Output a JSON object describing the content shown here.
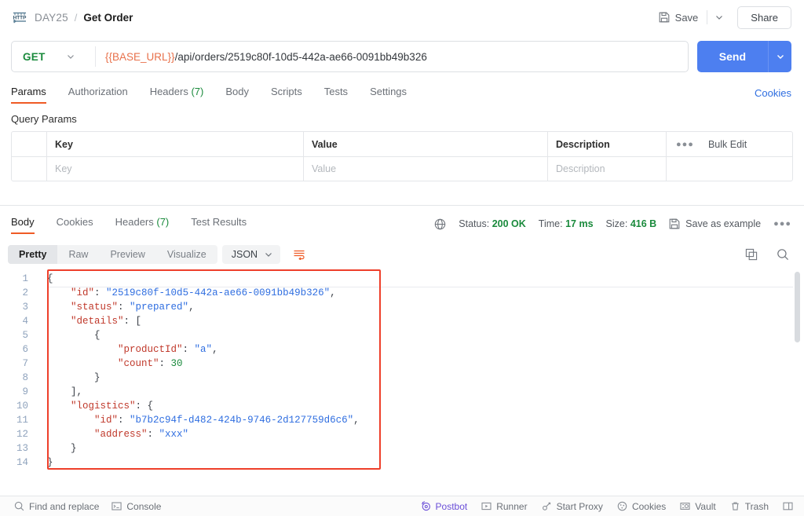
{
  "breadcrumb": {
    "icon": "http-icon",
    "collection": "DAY25",
    "separator": "/",
    "current": "Get Order"
  },
  "topbar": {
    "save_label": "Save",
    "save_icon": "floppy-disk-icon",
    "save_caret_icon": "chevron-down-icon",
    "share_label": "Share"
  },
  "request": {
    "method": "GET",
    "method_caret_icon": "chevron-down-icon",
    "url_variable": "{{BASE_URL}}",
    "url_path": "/api/orders/2519c80f-10d5-442a-ae66-0091bb49b326",
    "url_full": "{{BASE_URL}}/api/orders/2519c80f-10d5-442a-ae66-0091bb49b326",
    "send_label": "Send",
    "send_caret_icon": "chevron-down-icon",
    "tabs": [
      {
        "label": "Params",
        "active": true
      },
      {
        "label": "Authorization",
        "active": false
      },
      {
        "label": "Headers",
        "count": "(7)",
        "active": false
      },
      {
        "label": "Body",
        "active": false
      },
      {
        "label": "Scripts",
        "active": false
      },
      {
        "label": "Tests",
        "active": false
      },
      {
        "label": "Settings",
        "active": false
      }
    ],
    "cookies_link": "Cookies"
  },
  "query_params": {
    "title": "Query Params",
    "columns": [
      "Key",
      "Value",
      "Description"
    ],
    "bulk_edit_label": "Bulk Edit",
    "more_icon": "ellipsis-icon",
    "rows": [
      {
        "key": "Key",
        "value": "Value",
        "description": "Description",
        "placeholder": true
      }
    ]
  },
  "response": {
    "tabs": [
      {
        "label": "Body",
        "active": true
      },
      {
        "label": "Cookies",
        "active": false
      },
      {
        "label": "Headers",
        "count": "(7)",
        "active": false
      },
      {
        "label": "Test Results",
        "active": false
      }
    ],
    "globe_icon": "globe-icon",
    "status_label": "Status:",
    "status_value": "200 OK",
    "time_label": "Time:",
    "time_value": "17 ms",
    "size_label": "Size:",
    "size_value": "416 B",
    "save_example_label": "Save as example",
    "save_example_icon": "floppy-disk-icon",
    "more_icon": "ellipsis-icon",
    "view_modes": [
      {
        "label": "Pretty",
        "active": true
      },
      {
        "label": "Raw",
        "active": false
      },
      {
        "label": "Preview",
        "active": false
      },
      {
        "label": "Visualize",
        "active": false
      }
    ],
    "format": "JSON",
    "format_caret_icon": "chevron-down-icon",
    "wrap_icon": "wrap-lines-icon",
    "copy_icon": "copy-icon",
    "search_icon": "search-icon",
    "body_lines": [
      {
        "n": "1",
        "tokens": [
          {
            "t": "punct",
            "v": "{"
          }
        ]
      },
      {
        "n": "2",
        "tokens": [
          {
            "t": "punct",
            "v": "    "
          },
          {
            "t": "key",
            "v": "\"id\""
          },
          {
            "t": "punct",
            "v": ": "
          },
          {
            "t": "str",
            "v": "\"2519c80f-10d5-442a-ae66-0091bb49b326\""
          },
          {
            "t": "punct",
            "v": ","
          }
        ]
      },
      {
        "n": "3",
        "tokens": [
          {
            "t": "punct",
            "v": "    "
          },
          {
            "t": "key",
            "v": "\"status\""
          },
          {
            "t": "punct",
            "v": ": "
          },
          {
            "t": "str",
            "v": "\"prepared\""
          },
          {
            "t": "punct",
            "v": ","
          }
        ]
      },
      {
        "n": "4",
        "tokens": [
          {
            "t": "punct",
            "v": "    "
          },
          {
            "t": "key",
            "v": "\"details\""
          },
          {
            "t": "punct",
            "v": ": ["
          }
        ]
      },
      {
        "n": "5",
        "tokens": [
          {
            "t": "punct",
            "v": "        {"
          }
        ]
      },
      {
        "n": "6",
        "tokens": [
          {
            "t": "punct",
            "v": "            "
          },
          {
            "t": "key",
            "v": "\"productId\""
          },
          {
            "t": "punct",
            "v": ": "
          },
          {
            "t": "str",
            "v": "\"a\""
          },
          {
            "t": "punct",
            "v": ","
          }
        ]
      },
      {
        "n": "7",
        "tokens": [
          {
            "t": "punct",
            "v": "            "
          },
          {
            "t": "key",
            "v": "\"count\""
          },
          {
            "t": "punct",
            "v": ": "
          },
          {
            "t": "num",
            "v": "30"
          }
        ]
      },
      {
        "n": "8",
        "tokens": [
          {
            "t": "punct",
            "v": "        }"
          }
        ]
      },
      {
        "n": "9",
        "tokens": [
          {
            "t": "punct",
            "v": "    ],"
          }
        ]
      },
      {
        "n": "10",
        "tokens": [
          {
            "t": "punct",
            "v": "    "
          },
          {
            "t": "key",
            "v": "\"logistics\""
          },
          {
            "t": "punct",
            "v": ": {"
          }
        ]
      },
      {
        "n": "11",
        "tokens": [
          {
            "t": "punct",
            "v": "        "
          },
          {
            "t": "key",
            "v": "\"id\""
          },
          {
            "t": "punct",
            "v": ": "
          },
          {
            "t": "str",
            "v": "\"b7b2c94f-d482-424b-9746-2d127759d6c6\""
          },
          {
            "t": "punct",
            "v": ","
          }
        ]
      },
      {
        "n": "12",
        "tokens": [
          {
            "t": "punct",
            "v": "        "
          },
          {
            "t": "key",
            "v": "\"address\""
          },
          {
            "t": "punct",
            "v": ": "
          },
          {
            "t": "str",
            "v": "\"xxx\""
          }
        ]
      },
      {
        "n": "13",
        "tokens": [
          {
            "t": "punct",
            "v": "    }"
          }
        ]
      },
      {
        "n": "14",
        "tokens": [
          {
            "t": "punct",
            "v": "}"
          }
        ]
      }
    ]
  },
  "bottombar": {
    "left": [
      {
        "label": "Find and replace",
        "icon": "search-icon"
      },
      {
        "label": "Console",
        "icon": "terminal-icon"
      }
    ],
    "right": [
      {
        "label": "Postbot",
        "icon": "postbot-icon",
        "accent": true
      },
      {
        "label": "Runner",
        "icon": "play-box-icon"
      },
      {
        "label": "Start Proxy",
        "icon": "proxy-icon"
      },
      {
        "label": "Cookies",
        "icon": "cookie-icon"
      },
      {
        "label": "Vault",
        "icon": "vault-icon"
      },
      {
        "label": "Trash",
        "icon": "trash-icon"
      }
    ],
    "layout_icon": "layout-panel-icon"
  },
  "colors": {
    "accent_orange": "#ef5b25",
    "send_blue": "#4d7ff0",
    "status_green": "#1a8a3c",
    "link_blue": "#2f6ee0",
    "annotation_red": "#ee3f2a",
    "postbot_purple": "#6b4fd8",
    "variable_orange": "#e8704a"
  },
  "annotation": {
    "shape": "rectangle",
    "color": "#ee3f2a"
  }
}
